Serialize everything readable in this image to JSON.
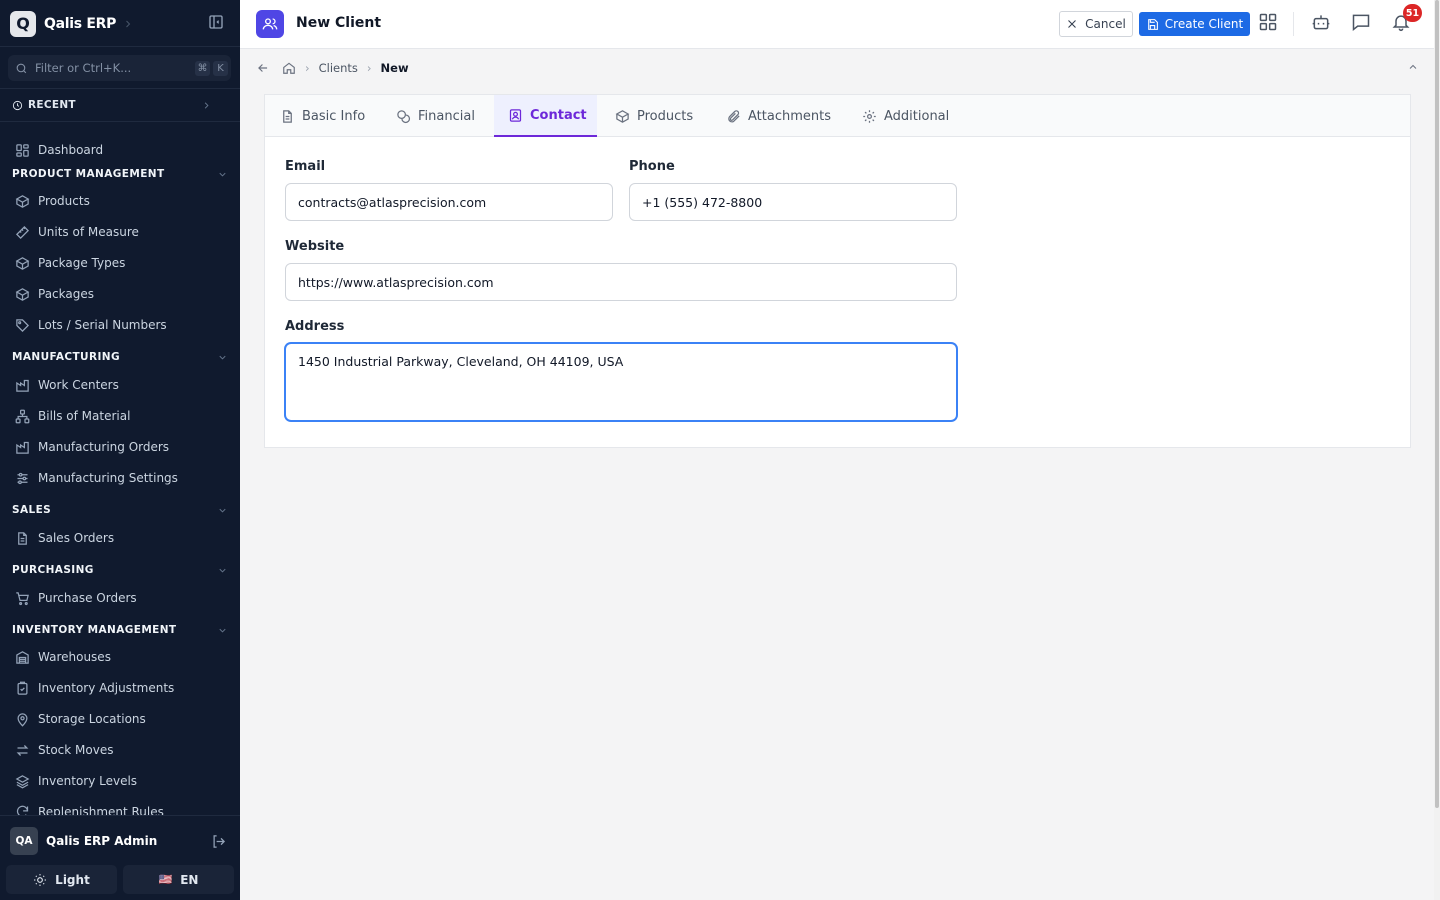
{
  "app": {
    "logo_letter": "Q",
    "name": "Qalis ERP"
  },
  "sidebar": {
    "filter_placeholder": "Filter or Ctrl+K...",
    "filter_kbd": [
      "⌘",
      "K"
    ],
    "recent_label": "RECENT",
    "dashboard_label": "Dashboard",
    "sections": [
      {
        "title": "PRODUCT MANAGEMENT",
        "items": [
          {
            "label": "Products",
            "icon": "box-icon"
          },
          {
            "label": "Units of Measure",
            "icon": "ruler-icon"
          },
          {
            "label": "Package Types",
            "icon": "box-icon"
          },
          {
            "label": "Packages",
            "icon": "box-icon"
          },
          {
            "label": "Lots / Serial Numbers",
            "icon": "tag-icon"
          }
        ]
      },
      {
        "title": "MANUFACTURING",
        "items": [
          {
            "label": "Work Centers",
            "icon": "factory-icon"
          },
          {
            "label": "Bills of Material",
            "icon": "network-icon"
          },
          {
            "label": "Manufacturing Orders",
            "icon": "factory-icon"
          },
          {
            "label": "Manufacturing Settings",
            "icon": "sliders-icon"
          }
        ]
      },
      {
        "title": "SALES",
        "items": [
          {
            "label": "Sales Orders",
            "icon": "document-icon"
          }
        ]
      },
      {
        "title": "PURCHASING",
        "items": [
          {
            "label": "Purchase Orders",
            "icon": "cart-icon"
          }
        ]
      },
      {
        "title": "INVENTORY MANAGEMENT",
        "items": [
          {
            "label": "Warehouses",
            "icon": "warehouse-icon"
          },
          {
            "label": "Inventory Adjustments",
            "icon": "clipboard-check-icon"
          },
          {
            "label": "Storage Locations",
            "icon": "map-pin-icon"
          },
          {
            "label": "Stock Moves",
            "icon": "arrows-icon"
          },
          {
            "label": "Inventory Levels",
            "icon": "layers-icon"
          },
          {
            "label": "Replenishment Rules",
            "icon": "refresh-icon"
          }
        ]
      }
    ],
    "user": {
      "initials": "QA",
      "name": "Qalis ERP Admin"
    },
    "theme_label": "Light",
    "lang_flag": "🇺🇸",
    "lang_label": "EN"
  },
  "header": {
    "title": "New Client",
    "cancel_label": "Cancel",
    "create_label": "Create Client",
    "notification_count": "51"
  },
  "breadcrumb": {
    "items": [
      "Clients",
      "New"
    ]
  },
  "tabs": [
    {
      "label": "Basic Info",
      "icon": "file-text-icon",
      "active": false
    },
    {
      "label": "Financial",
      "icon": "coins-icon",
      "active": false
    },
    {
      "label": "Contact",
      "icon": "contact-icon",
      "active": true
    },
    {
      "label": "Products",
      "icon": "box-icon",
      "active": false
    },
    {
      "label": "Attachments",
      "icon": "paperclip-icon",
      "active": false
    },
    {
      "label": "Additional",
      "icon": "gear-icon",
      "active": false
    }
  ],
  "form": {
    "email": {
      "label": "Email",
      "value": "contracts@atlasprecision.com"
    },
    "phone": {
      "label": "Phone",
      "value": "+1 (555) 472-8800"
    },
    "website": {
      "label": "Website",
      "value": "https://www.atlasprecision.com"
    },
    "address": {
      "label": "Address",
      "value": "1450 Industrial Parkway, Cleveland, OH 44109, USA"
    }
  },
  "colors": {
    "sidebar_bg": "#101a2e",
    "accent_blue": "#1d6ae5",
    "active_tab": "#6d28d9",
    "badge_red": "#dc2626",
    "header_icon_bg": "#4f46e5"
  }
}
